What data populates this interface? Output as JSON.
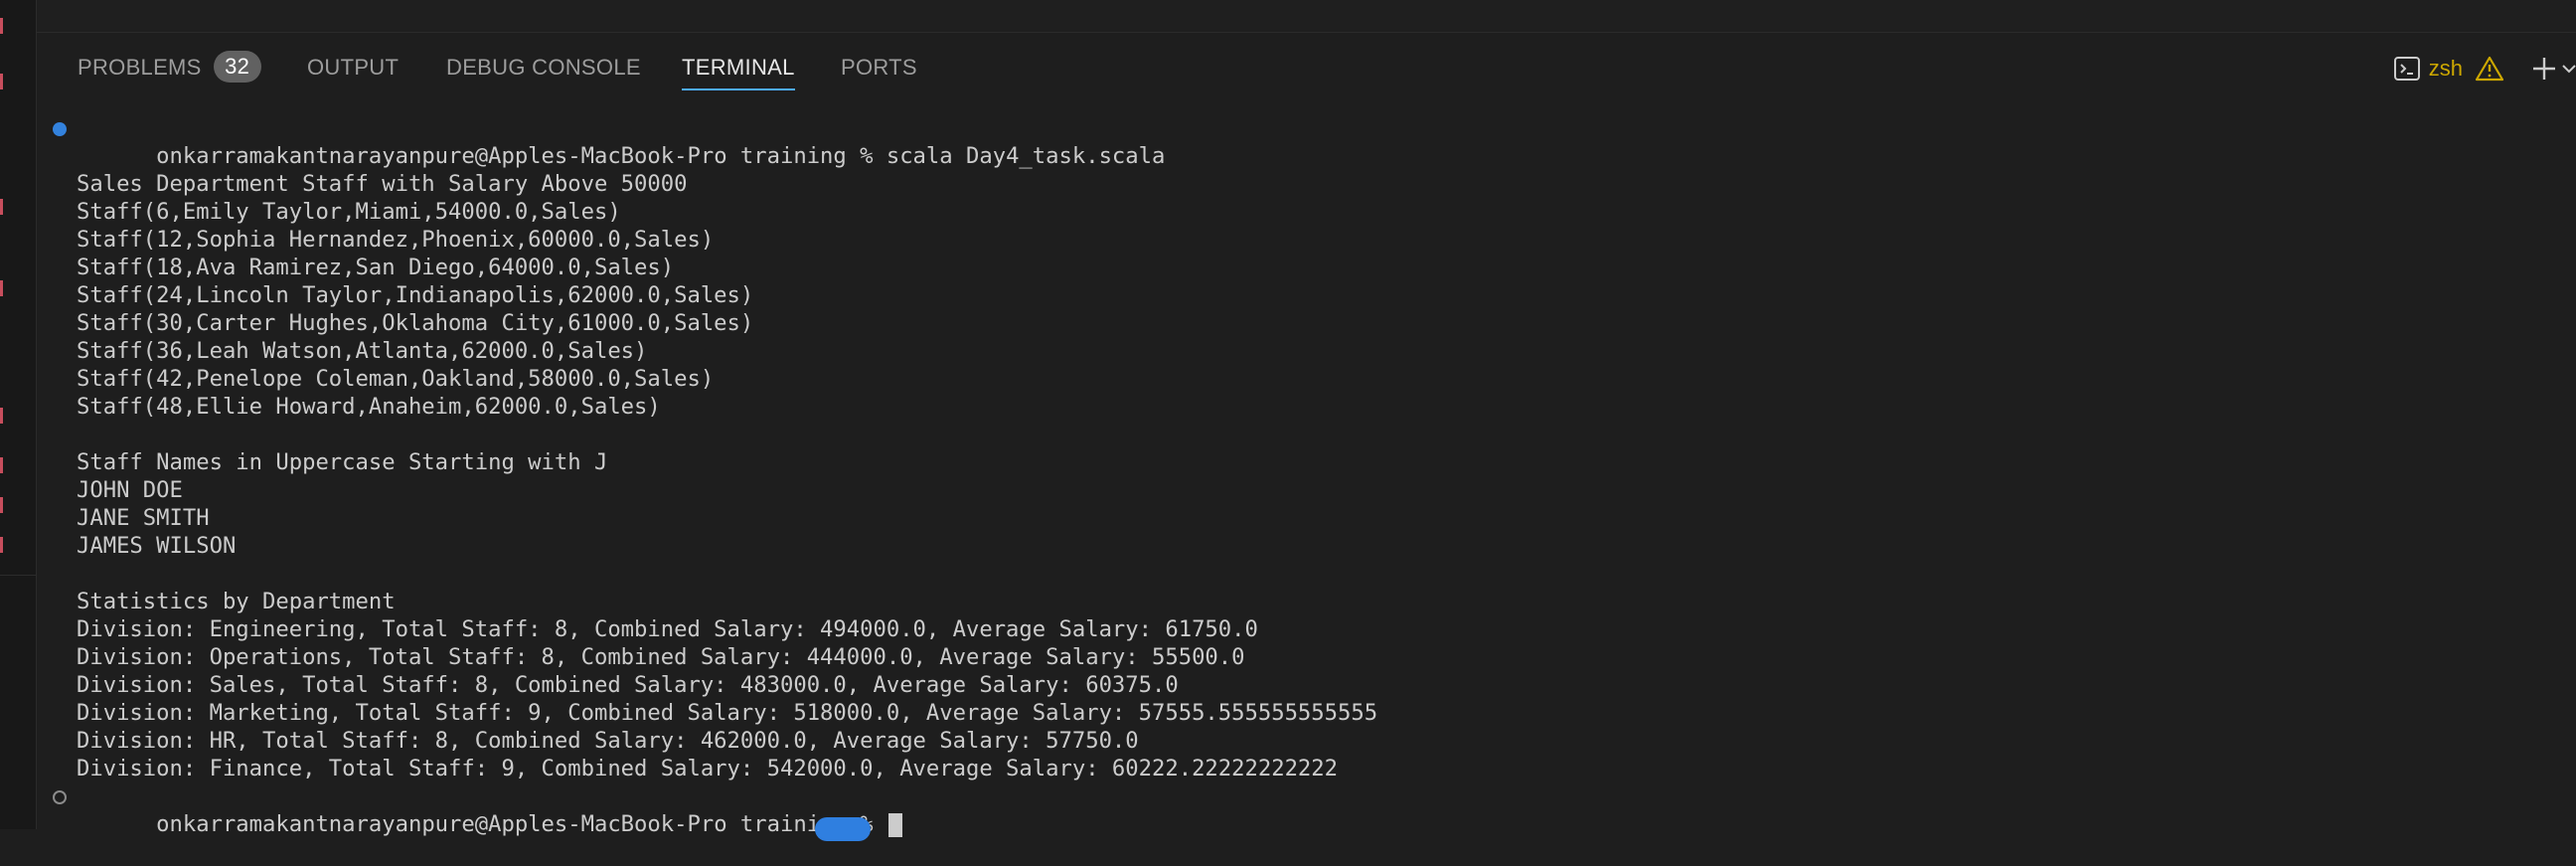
{
  "tabs": [
    {
      "label": "PROBLEMS",
      "badge": "32"
    },
    {
      "label": "OUTPUT"
    },
    {
      "label": "DEBUG CONSOLE"
    },
    {
      "label": "TERMINAL"
    },
    {
      "label": "PORTS"
    }
  ],
  "active_tab": "TERMINAL",
  "shell": {
    "name": "zsh",
    "icon": "terminal-icon",
    "warning_icon": "warning-icon",
    "add_icon": "plus-icon",
    "menu_icon": "chevron-down-icon"
  },
  "colors": {
    "accent": "#4daafc",
    "warning": "#cca700",
    "badge_bg": "#616161"
  },
  "terminal": {
    "command_line": "onkarramakantnarayanpure@Apples-MacBook-Pro training % scala Day4_task.scala",
    "output": [
      "",
      "Sales Department Staff with Salary Above 50000",
      "Staff(6,Emily Taylor,Miami,54000.0,Sales)",
      "Staff(12,Sophia Hernandez,Phoenix,60000.0,Sales)",
      "Staff(18,Ava Ramirez,San Diego,64000.0,Sales)",
      "Staff(24,Lincoln Taylor,Indianapolis,62000.0,Sales)",
      "Staff(30,Carter Hughes,Oklahoma City,61000.0,Sales)",
      "Staff(36,Leah Watson,Atlanta,62000.0,Sales)",
      "Staff(42,Penelope Coleman,Oakland,58000.0,Sales)",
      "Staff(48,Ellie Howard,Anaheim,62000.0,Sales)",
      "",
      "Staff Names in Uppercase Starting with J",
      "JOHN DOE",
      "JANE SMITH",
      "JAMES WILSON",
      "",
      "Statistics by Department",
      "Division: Engineering, Total Staff: 8, Combined Salary: 494000.0, Average Salary: 61750.0",
      "Division: Operations, Total Staff: 8, Combined Salary: 444000.0, Average Salary: 55500.0",
      "Division: Sales, Total Staff: 8, Combined Salary: 483000.0, Average Salary: 60375.0",
      "Division: Marketing, Total Staff: 9, Combined Salary: 518000.0, Average Salary: 57555.555555555555",
      "Division: HR, Total Staff: 8, Combined Salary: 462000.0, Average Salary: 57750.0",
      "Division: Finance, Total Staff: 9, Combined Salary: 542000.0, Average Salary: 60222.22222222222"
    ],
    "prompt": "onkarramakantnarayanpure@Apples-MacBook-Pro training % "
  }
}
